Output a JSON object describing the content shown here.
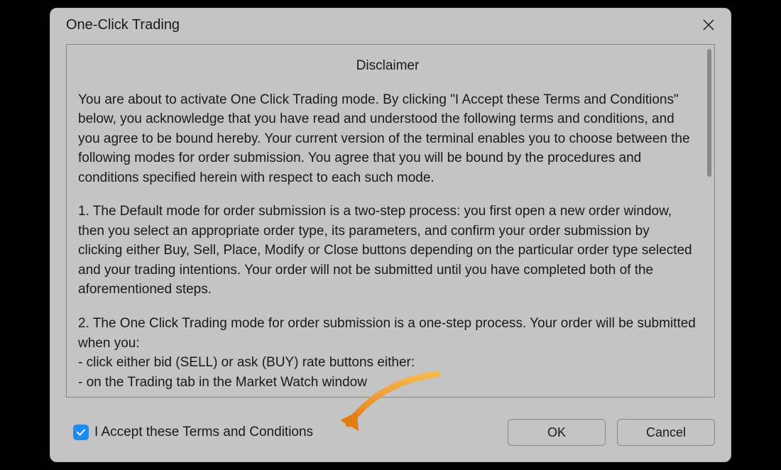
{
  "dialog": {
    "title": "One-Click Trading"
  },
  "content": {
    "heading": "Disclaimer",
    "para1": "You are about to activate One Click Trading mode. By clicking \"I Accept these Terms and Conditions\" below, you acknowledge that you have read and understood the following terms and conditions, and you agree to be bound hereby. Your current version of the terminal enables you to choose between the following modes for order submission. You agree that you will be bound by the procedures and conditions specified herein with respect to each such mode.",
    "para2": "1. The Default mode for order submission is a two-step process: you first open a new order window, then you select an appropriate order type, its parameters, and confirm your order submission by clicking either Buy, Sell, Place, Modify or Close buttons depending on the particular order type selected and your trading intentions. Your order will not be submitted until you have completed both of the aforementioned steps.",
    "para3": "2. The One Click Trading mode for order submission is a one-step process. Your order will be submitted when you:\n- click either bid (SELL) or ask (BUY) rate buttons either:\n      - on the Trading tab in the Market Watch window"
  },
  "footer": {
    "accept_label": "I Accept these Terms and Conditions",
    "ok_label": "OK",
    "cancel_label": "Cancel"
  }
}
